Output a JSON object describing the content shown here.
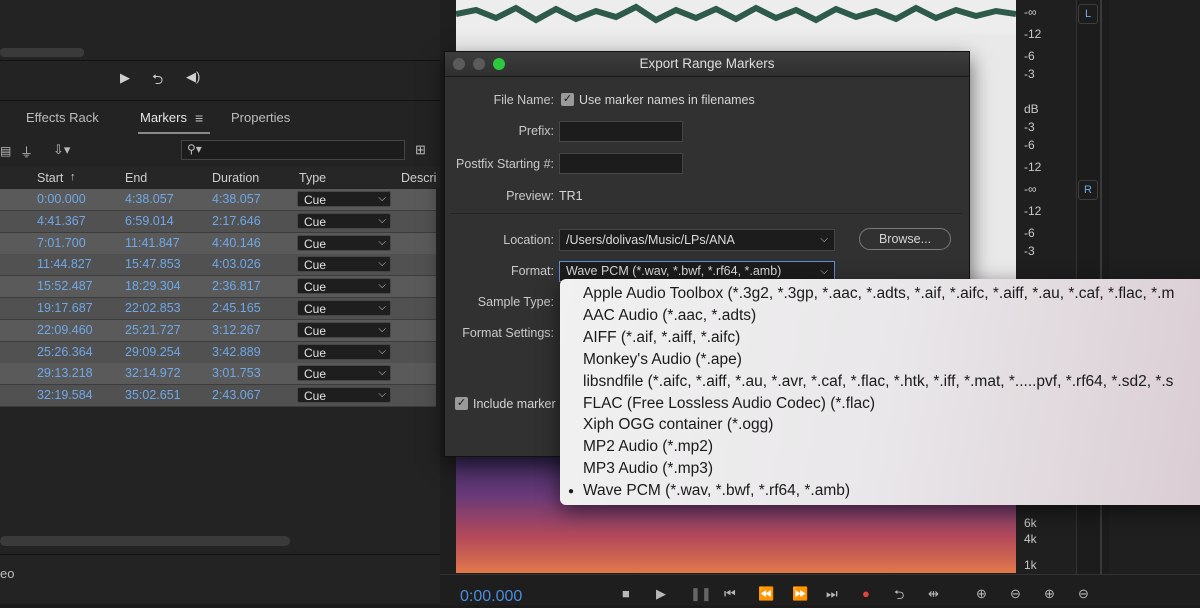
{
  "left_panel": {
    "tabs": [
      "Effects Rack",
      "Markers",
      "Properties"
    ],
    "columns": [
      "Start",
      "End",
      "Duration",
      "Type",
      "Descri"
    ],
    "rows": [
      {
        "start": "0:00.000",
        "end": "4:38.057",
        "duration": "4:38.057",
        "type": "Cue"
      },
      {
        "start": "4:41.367",
        "end": "6:59.014",
        "duration": "2:17.646",
        "type": "Cue"
      },
      {
        "start": "7:01.700",
        "end": "11:41.847",
        "duration": "4:40.146",
        "type": "Cue"
      },
      {
        "start": "11:44.827",
        "end": "15:47.853",
        "duration": "4:03.026",
        "type": "Cue"
      },
      {
        "start": "15:52.487",
        "end": "18:29.304",
        "duration": "2:36.817",
        "type": "Cue"
      },
      {
        "start": "19:17.687",
        "end": "22:02.853",
        "duration": "2:45.165",
        "type": "Cue"
      },
      {
        "start": "22:09.460",
        "end": "25:21.727",
        "duration": "3:12.267",
        "type": "Cue"
      },
      {
        "start": "25:26.364",
        "end": "29:09.254",
        "duration": "3:42.889",
        "type": "Cue"
      },
      {
        "start": "29:13.218",
        "end": "32:14.972",
        "duration": "3:01.753",
        "type": "Cue"
      },
      {
        "start": "32:19.584",
        "end": "35:02.651",
        "duration": "2:43.067",
        "type": "Cue"
      }
    ],
    "bottom_label": "eo"
  },
  "dialog": {
    "title": "Export Range Markers",
    "file_name_label": "File Name:",
    "use_marker_names": "Use marker names in filenames",
    "prefix_label": "Prefix:",
    "prefix_value": "",
    "postfix_label": "Postfix Starting #:",
    "postfix_value": "",
    "preview_label": "Preview:",
    "preview_value": "TR1",
    "location_label": "Location:",
    "location_value": "/Users/dolivas/Music/LPs/ANA",
    "browse_label": "Browse...",
    "format_label": "Format:",
    "format_value": "Wave PCM (*.wav, *.bwf, *.rf64, *.amb)",
    "sample_type_label": "Sample Type:",
    "format_settings_label": "Format Settings:",
    "include_markers_label": "Include marker"
  },
  "format_menu": {
    "items": [
      "Apple Audio Toolbox (*.3g2, *.3gp, *.aac, *.adts, *.aif, *.aifc, *.aiff, *.au, *.caf, *.flac, *.m",
      "AAC Audio (*.aac, *.adts)",
      "AIFF (*.aif, *.aiff, *.aifc)",
      "Monkey's Audio (*.ape)",
      "libsndfile (*.aifc, *.aiff, *.au, *.avr, *.caf, *.flac, *.htk, *.iff, *.mat, *.....pvf, *.rf64, *.sd2, *.s",
      "FLAC (Free Lossless Audio Codec) (*.flac)",
      "Xiph OGG container (*.ogg)",
      "MP2 Audio (*.mp2)",
      "MP3 Audio (*.mp3)",
      "Wave PCM (*.wav, *.bwf, *.rf64, *.amb)"
    ],
    "selected_index": 9
  },
  "meters": {
    "top": [
      "-∞",
      "-12",
      "-6",
      "-3"
    ],
    "db_label": "dB",
    "mid": [
      "-3",
      "-6",
      "-12",
      "-∞",
      "-12",
      "-6",
      "-3"
    ],
    "channel_left": "L",
    "channel_right": "R",
    "freq": [
      "6k",
      "4k",
      "1k"
    ]
  },
  "transport": {
    "timecode": "0:00.000"
  },
  "colors": {
    "accent_blue": "#6fa8e8",
    "record_red": "#e0443c",
    "green_light": "#2cc840"
  }
}
